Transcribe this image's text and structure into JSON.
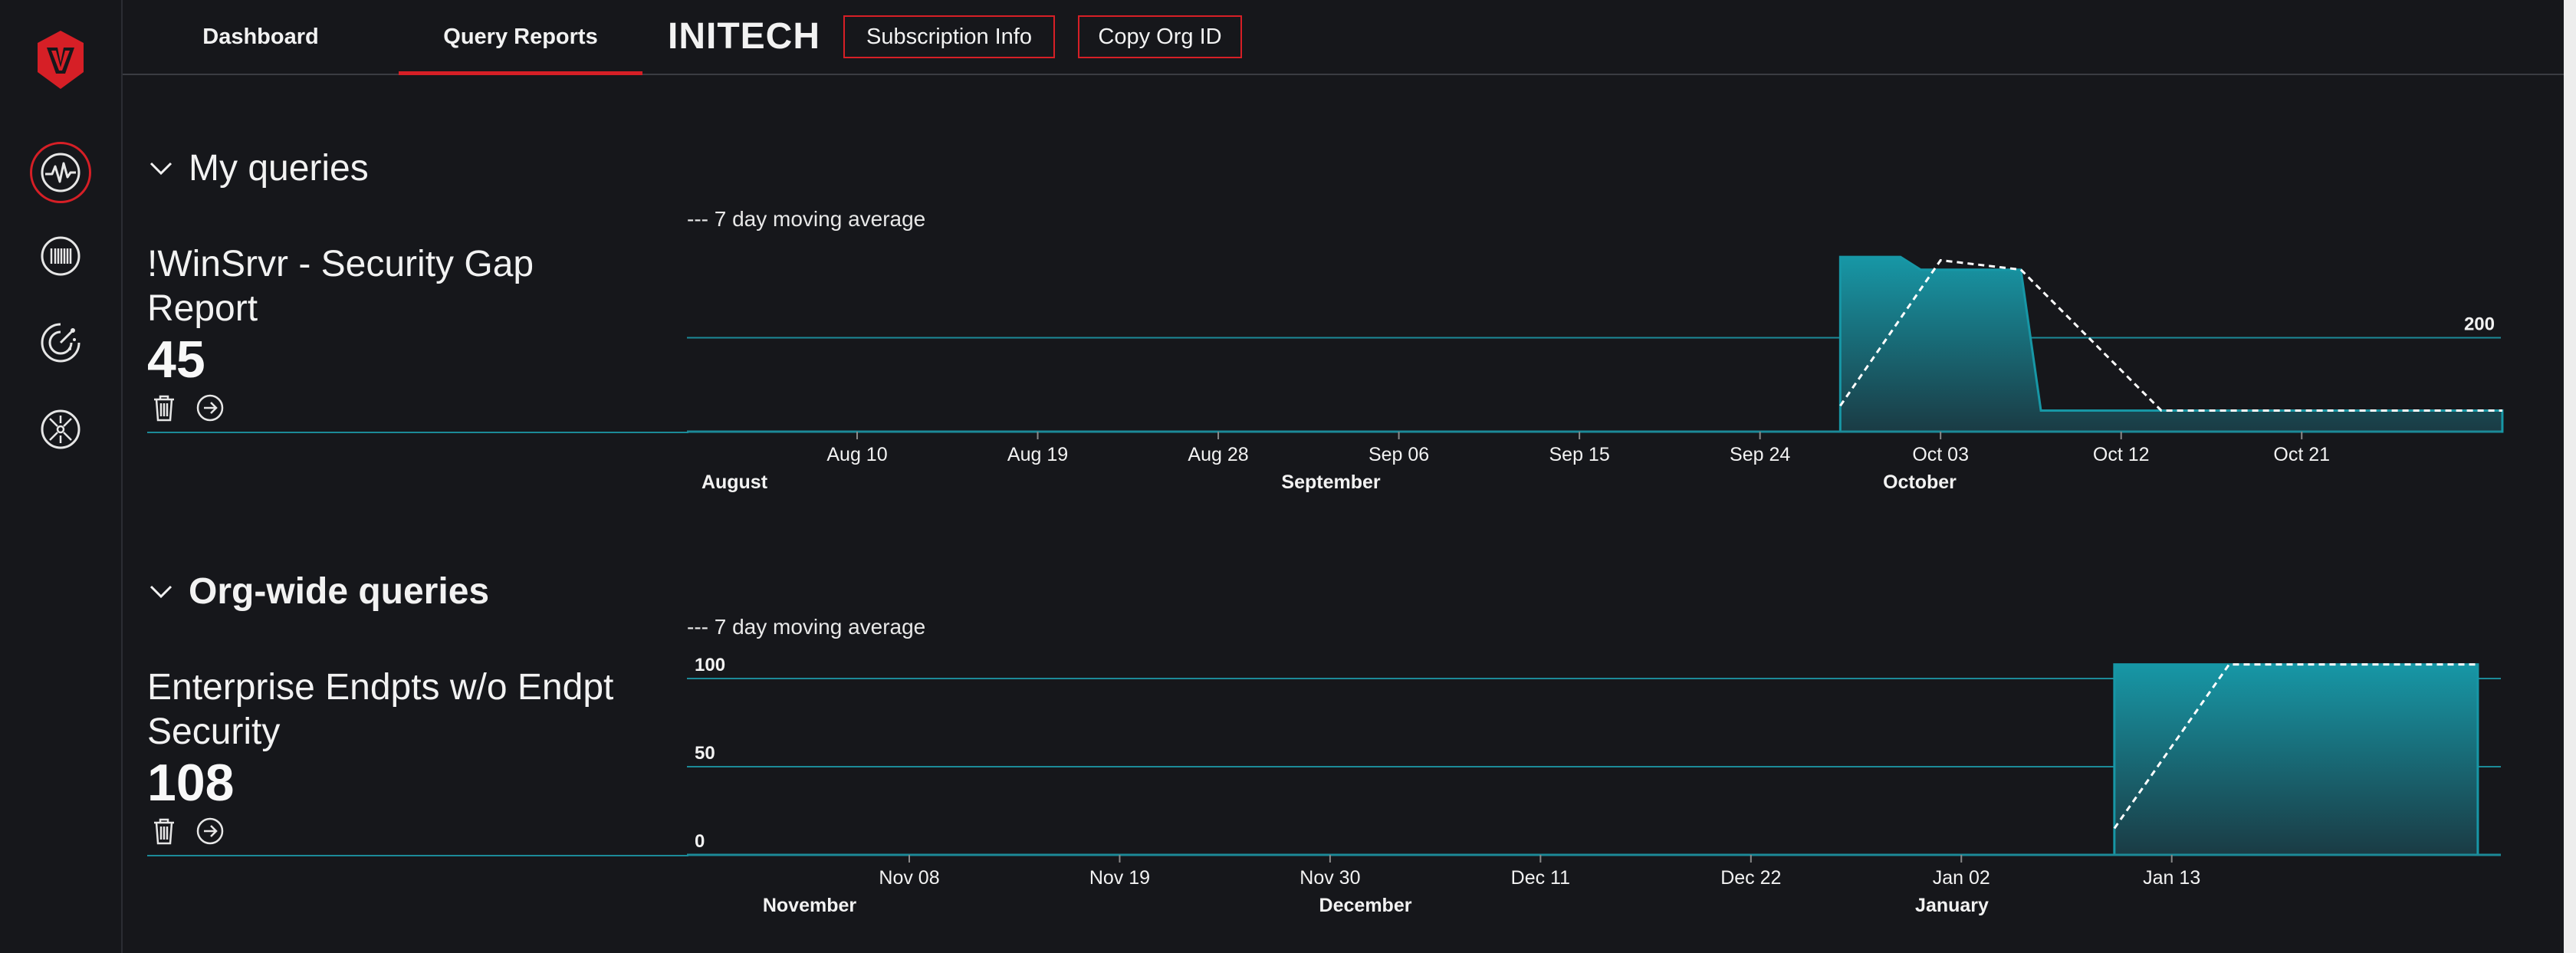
{
  "nav": {
    "tabs": [
      {
        "label": "Dashboard"
      },
      {
        "label": "Query Reports"
      }
    ],
    "active_tab": "Query Reports",
    "org_name": "INITECH",
    "subscription_button": "Subscription Info",
    "copy_org_button": "Copy Org ID"
  },
  "sidebar": {
    "items": [
      {
        "icon": "pulse-icon",
        "active": true
      },
      {
        "icon": "barcode-icon",
        "active": false
      },
      {
        "icon": "radar-icon",
        "active": false
      },
      {
        "icon": "network-hub-icon",
        "active": false
      }
    ],
    "accent": "#d61f26"
  },
  "my_queries": {
    "header": "My queries",
    "query": {
      "title": "!WinSrvr - Security Gap Report",
      "count": "45"
    },
    "chart_note": "--- 7 day moving average"
  },
  "org_queries": {
    "header": "Org-wide queries",
    "query": {
      "title": "Enterprise Endpts w/o Endpt Security",
      "count": "108"
    },
    "chart_note": "--- 7 day moving average"
  },
  "chart_data": [
    {
      "type": "area",
      "x_ticks": [
        "Aug 10",
        "Aug 19",
        "Aug 28",
        "Sep 06",
        "Sep 15",
        "Sep 24",
        "Oct 03",
        "Oct 12",
        "Oct 21"
      ],
      "months": [
        "August",
        "September",
        "October"
      ],
      "y_ticks": [
        "200"
      ],
      "ylim": [
        0,
        400
      ],
      "color": "#1797a6",
      "series": [
        {
          "x": [
            "Sep 28",
            "Oct 01",
            "Oct 02",
            "Oct 07",
            "Oct 08",
            "Oct 31"
          ],
          "values": [
            372,
            372,
            345,
            345,
            45,
            45
          ]
        }
      ],
      "moving_average": [
        {
          "x": "Sep 28",
          "value": 55
        },
        {
          "x": "Oct 03",
          "value": 365
        },
        {
          "x": "Oct 07",
          "value": 345
        },
        {
          "x": "Oct 14",
          "value": 45
        },
        {
          "x": "Oct 31",
          "value": 45
        }
      ]
    },
    {
      "type": "area",
      "x_ticks": [
        "Nov 08",
        "Nov 19",
        "Nov 30",
        "Dec 11",
        "Dec 22",
        "Jan 02",
        "Jan 13"
      ],
      "months": [
        "November",
        "December",
        "January"
      ],
      "y_ticks": [
        "0",
        "50",
        "100"
      ],
      "ylim": [
        0,
        100
      ],
      "color": "#1797a6",
      "series": [
        {
          "x": [
            "Jan 10",
            "Jan 29"
          ],
          "values": [
            108,
            108
          ]
        }
      ],
      "moving_average": [
        {
          "x": "Jan 10",
          "value": 15
        },
        {
          "x": "Jan 16",
          "value": 108
        },
        {
          "x": "Jan 29",
          "value": 108
        }
      ]
    }
  ]
}
